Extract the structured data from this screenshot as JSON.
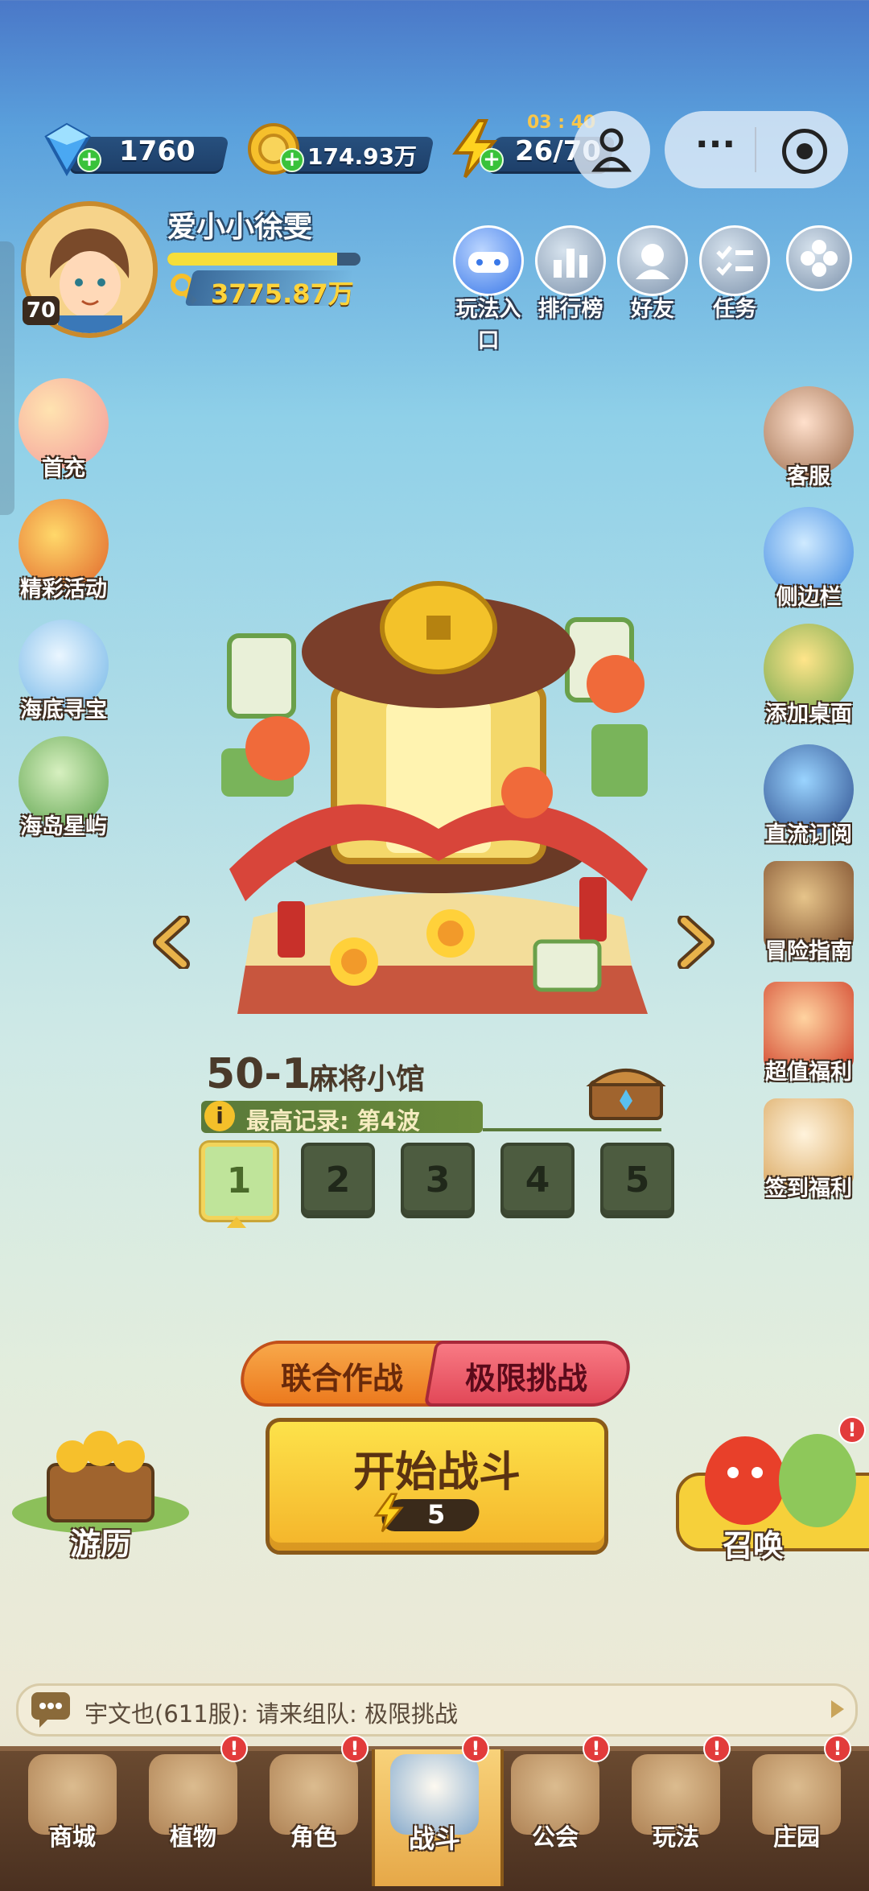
{
  "resources": {
    "gems": "1760",
    "coins": "174.93万",
    "energy": "26/70",
    "energy_timer": "03 : 40"
  },
  "player": {
    "name": "爱小小徐雯",
    "level": "70",
    "power": "3775.87万",
    "exp_fraction": 0.88
  },
  "top_menu": [
    {
      "label": "玩法入口"
    },
    {
      "label": "排行榜"
    },
    {
      "label": "好友"
    },
    {
      "label": "任务"
    }
  ],
  "left_menu": [
    {
      "label": "首充"
    },
    {
      "label": "精彩活动"
    },
    {
      "label": "海底寻宝"
    },
    {
      "label": "海岛星屿"
    }
  ],
  "right_menu": [
    {
      "label": "客服"
    },
    {
      "label": "侧边栏"
    },
    {
      "label": "添加桌面"
    },
    {
      "label": "直流订阅"
    },
    {
      "label": "冒险指南"
    },
    {
      "label": "超值福利"
    },
    {
      "label": "签到福利"
    }
  ],
  "stage": {
    "number": "50-1",
    "name": "麻将小馆",
    "record": "最高记录: 第4波",
    "waves": [
      "1",
      "2",
      "3",
      "4",
      "5"
    ],
    "selected_wave": "1"
  },
  "modes": {
    "coop": "联合作战",
    "extreme": "极限挑战"
  },
  "battle": {
    "start_label": "开始战斗",
    "cost": "5"
  },
  "travel_label": "游历",
  "summon_label": "召唤",
  "chat": {
    "message": "宇文也(611服): 请来组队: 极限挑战"
  },
  "bottom_nav": [
    {
      "label": "商城"
    },
    {
      "label": "植物"
    },
    {
      "label": "角色"
    },
    {
      "label": "战斗"
    },
    {
      "label": "公会"
    },
    {
      "label": "玩法"
    },
    {
      "label": "庄园"
    }
  ],
  "badge_mark": "!",
  "colors": {
    "start_button": "#f6c431",
    "coop_button": "#f08a2a",
    "extreme_button": "#e8505c",
    "nav_bar": "#5a3a26"
  }
}
